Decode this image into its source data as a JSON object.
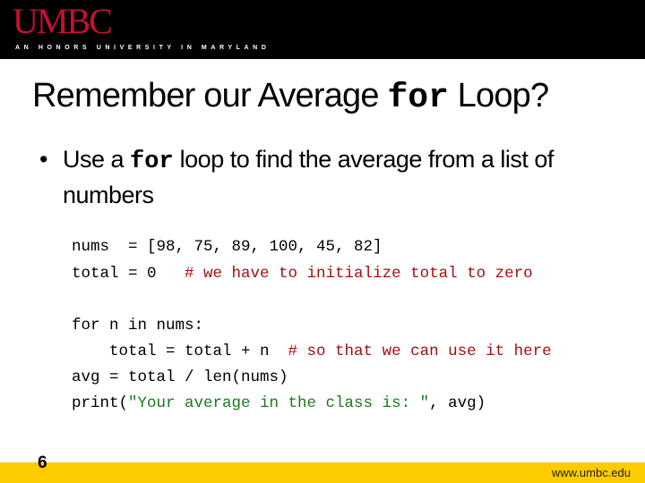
{
  "header": {
    "logo": "UMBC",
    "tagline": "AN HONORS UNIVERSITY IN MARYLAND"
  },
  "slide": {
    "title_pre": "Remember our Average ",
    "title_code": "for",
    "title_post": " Loop?",
    "bullet_pre": "Use a ",
    "bullet_code": "for",
    "bullet_post": " loop to find the average from a list of numbers",
    "code_lines": [
      {
        "code": "nums  = [98, 75, 89, 100, 45, 82]",
        "comment": ""
      },
      {
        "code": "total = 0   ",
        "comment": "# we have to initialize total to zero"
      },
      {
        "code": "for n in nums:",
        "comment": ""
      },
      {
        "code": "    total = total + n  ",
        "comment": "# so that we can use it here"
      },
      {
        "code": "avg = total / len(nums)",
        "comment": ""
      },
      {
        "code_pre": "print(",
        "string": "\"Your average in the class is: \"",
        "code_post": ", avg)"
      }
    ]
  },
  "footer": {
    "page_number": "6",
    "url": "www.umbc.edu"
  }
}
